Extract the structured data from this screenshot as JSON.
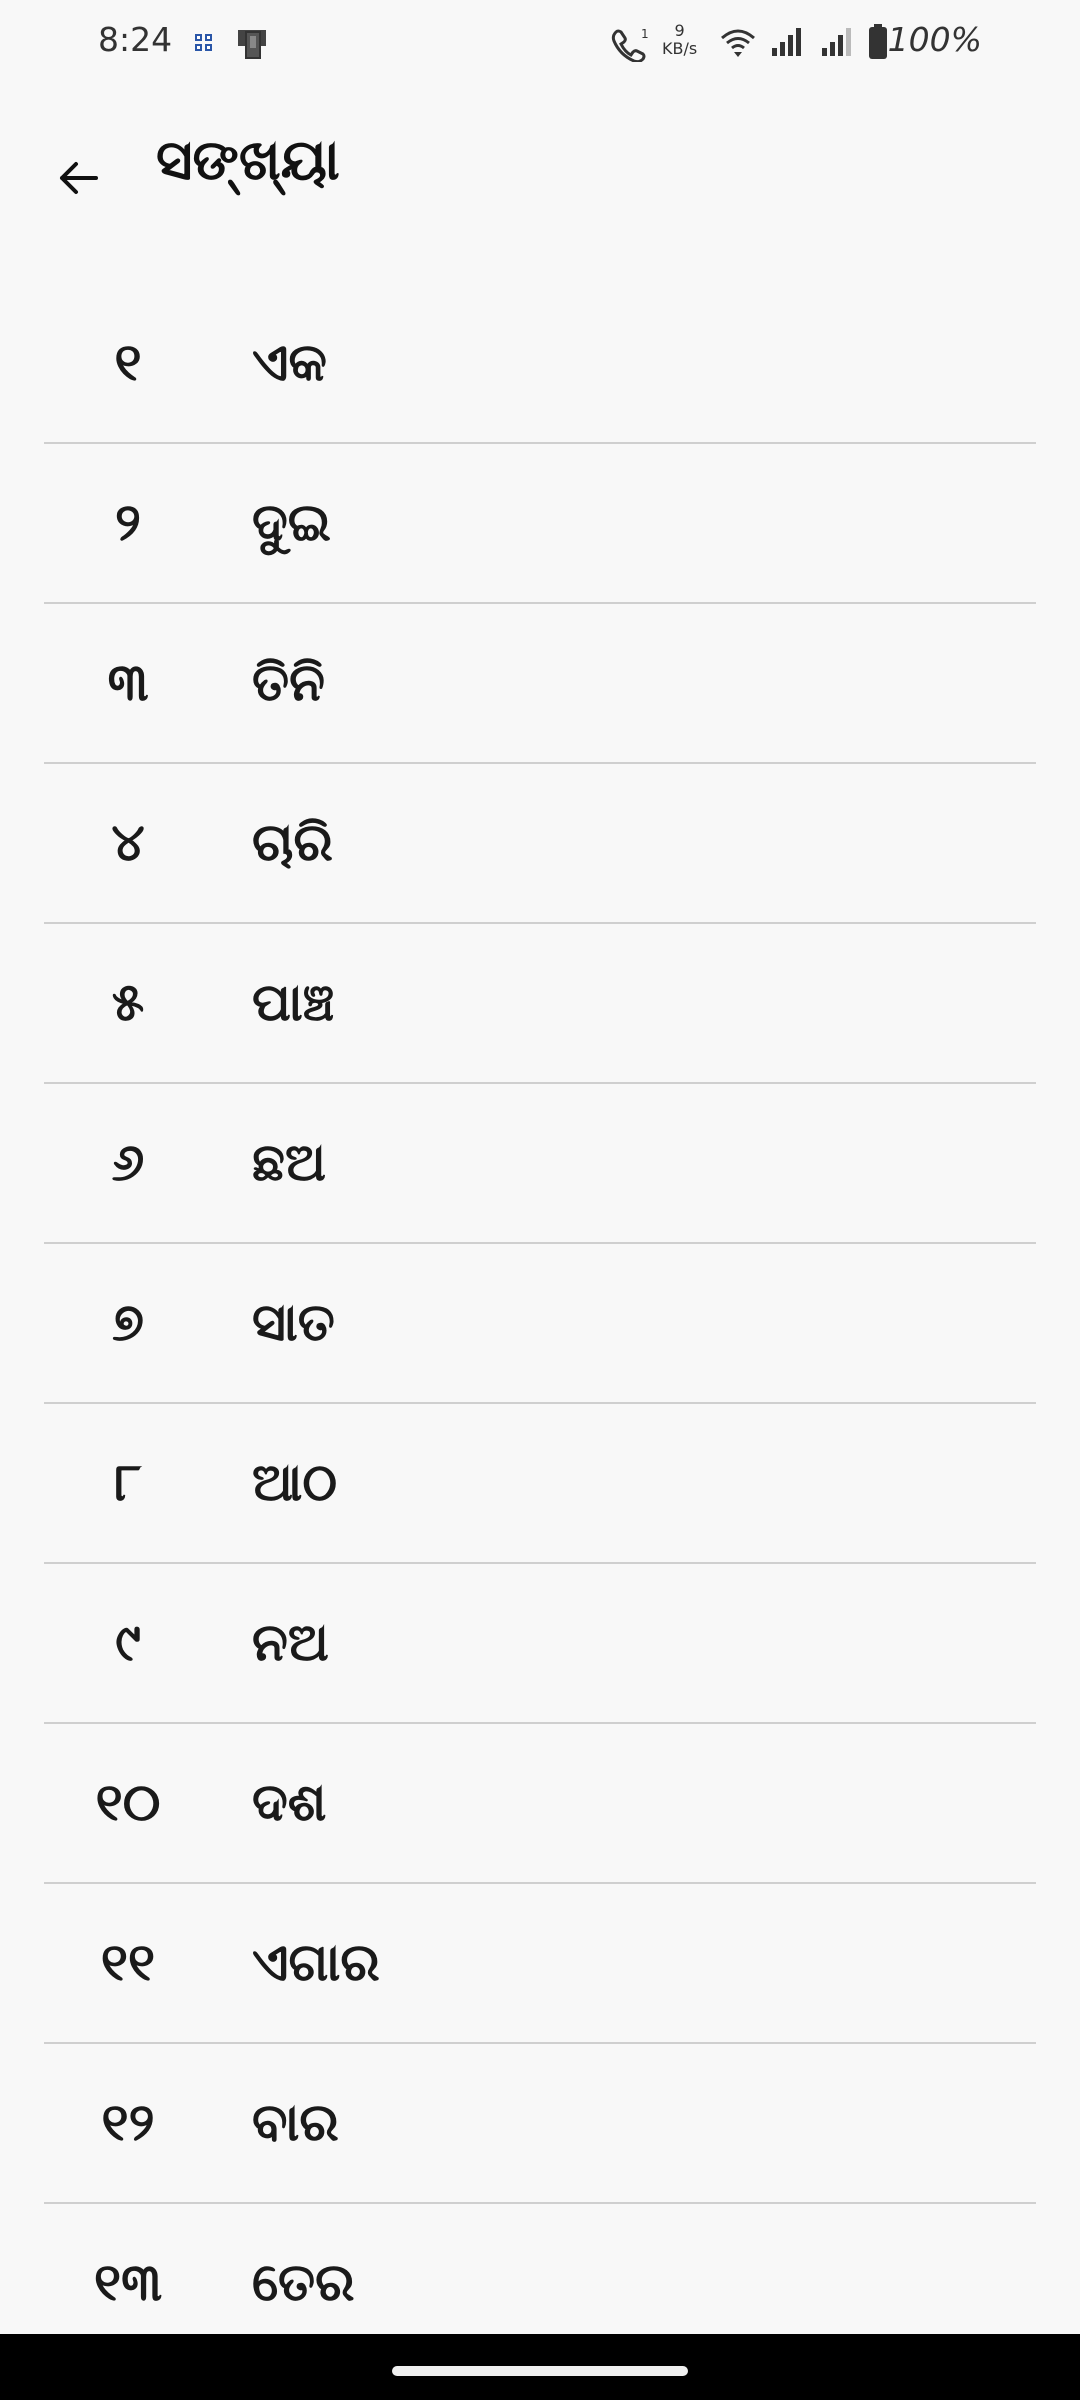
{
  "status_bar": {
    "time": "8:24",
    "network_speed_value": "9",
    "network_speed_unit": "KB/s",
    "battery_text": "100%"
  },
  "app_bar": {
    "title": "ସଙ୍ଖ୍ୟା",
    "back_icon": "arrow-left-icon"
  },
  "numbers": [
    {
      "digit": "୧",
      "word": "ଏକ"
    },
    {
      "digit": "୨",
      "word": "ଦୁଇ"
    },
    {
      "digit": "୩",
      "word": "ତିନି"
    },
    {
      "digit": "୪",
      "word": "ଚାରି"
    },
    {
      "digit": "୫",
      "word": "ପାଞ୍ଚ"
    },
    {
      "digit": "୬",
      "word": "ଛଅ"
    },
    {
      "digit": "୭",
      "word": "ସାତ"
    },
    {
      "digit": "୮",
      "word": "ଆଠ"
    },
    {
      "digit": "୯",
      "word": "ନଅ"
    },
    {
      "digit": "୧୦",
      "word": "ଦଶ"
    },
    {
      "digit": "୧୧",
      "word": "ଏଗାର"
    },
    {
      "digit": "୧୨",
      "word": "ବାର"
    },
    {
      "digit": "୧୩",
      "word": "ତେର"
    }
  ]
}
